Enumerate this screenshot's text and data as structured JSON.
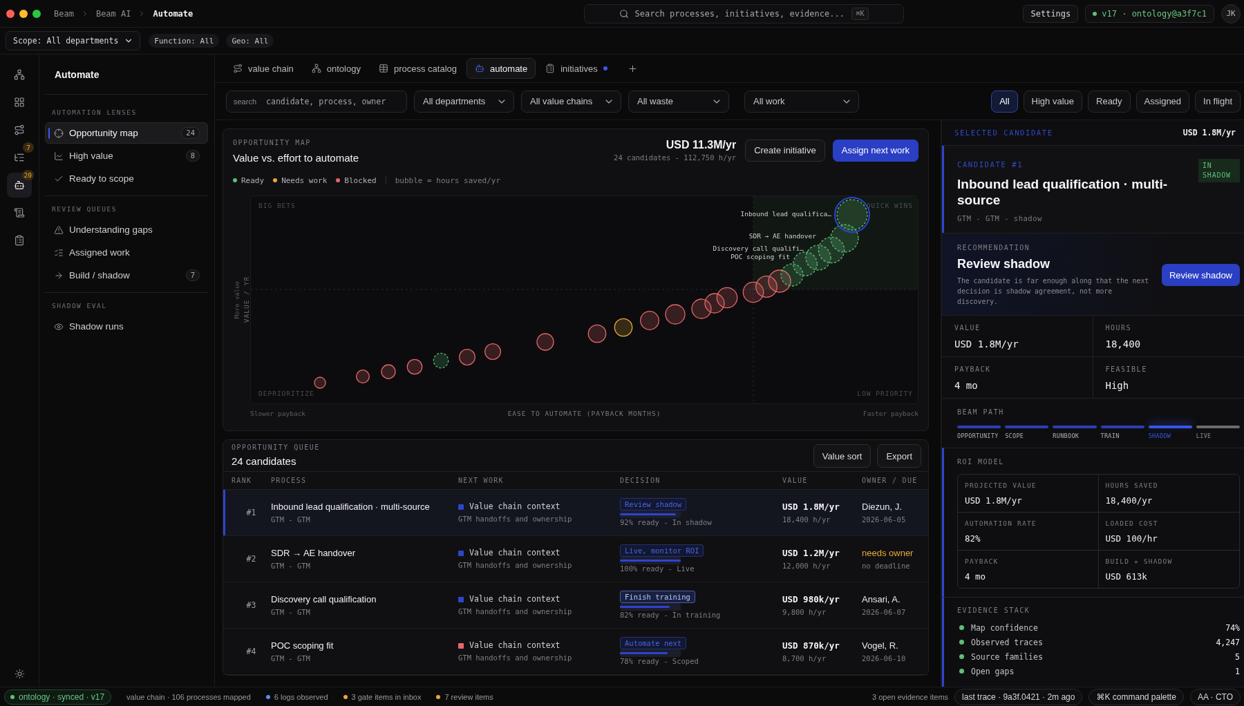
{
  "breadcrumb": [
    {
      "label": "Beam",
      "current": false
    },
    {
      "label": "Beam AI",
      "current": false
    },
    {
      "label": "Automate",
      "current": true
    }
  ],
  "command_search": {
    "placeholder": "Search processes, initiatives, evidence...",
    "shortcut": "⌘K"
  },
  "header_actions": {
    "settings": "Settings",
    "version": "v17 · ontology@a3f7c1",
    "avatar": "JK"
  },
  "scope_bar": {
    "scope": "Scope: All departments",
    "chips": [
      "Function: All",
      "Geo: All"
    ]
  },
  "rail": [
    {
      "selected": false
    },
    {
      "selected": false
    },
    {
      "selected": false
    },
    {
      "badge": "7",
      "selected": false
    },
    {
      "badge": "20",
      "selected": true
    },
    {
      "selected": false
    },
    {
      "selected": false
    }
  ],
  "sidebar": {
    "title": "Automate",
    "sections": [
      {
        "heading": "AUTOMATION LENSES",
        "items": [
          {
            "label": "Opportunity map",
            "count": "24",
            "selected": true
          },
          {
            "label": "High value",
            "count": "8",
            "selected": false
          },
          {
            "label": "Ready to scope",
            "selected": false
          }
        ]
      },
      {
        "heading": "REVIEW QUEUES",
        "items": [
          {
            "label": "Understanding gaps",
            "selected": false
          },
          {
            "label": "Assigned work",
            "selected": false
          },
          {
            "label": "Build / shadow",
            "count": "7",
            "selected": false
          }
        ]
      },
      {
        "heading": "SHADOW EVAL",
        "items": [
          {
            "label": "Shadow runs",
            "selected": false
          }
        ]
      }
    ]
  },
  "tabs": [
    {
      "label": "value chain",
      "selected": false,
      "unread": false
    },
    {
      "label": "ontology",
      "selected": false,
      "unread": false
    },
    {
      "label": "process catalog",
      "selected": false,
      "unread": false
    },
    {
      "label": "automate",
      "selected": true,
      "unread": false
    },
    {
      "label": "initiatives",
      "selected": false,
      "unread": true
    }
  ],
  "filters": {
    "search": {
      "label": "search",
      "placeholder": "candidate, process, owner"
    },
    "dropdowns": [
      "All departments",
      "All value chains",
      "All waste",
      "All work"
    ],
    "segments": [
      {
        "label": "All",
        "selected": true
      },
      {
        "label": "High value",
        "selected": false
      },
      {
        "label": "Ready",
        "selected": false
      },
      {
        "label": "Assigned",
        "selected": false
      },
      {
        "label": "In flight",
        "selected": false
      }
    ]
  },
  "opportunity_map": {
    "eyebrow": "OPPORTUNITY MAP",
    "title": "Value vs. effort to automate",
    "total": "USD 11.3M/yr",
    "subtotal": "24 candidates - 112,750 h/yr",
    "buttons": [
      {
        "label": "Create initiative",
        "primary": false
      },
      {
        "label": "Assign next work",
        "primary": true
      }
    ],
    "legend": [
      {
        "label": "Ready",
        "color": "#5fbf78"
      },
      {
        "label": "Needs work",
        "color": "#e8a93b"
      },
      {
        "label": "Blocked",
        "color": "#e5676a"
      }
    ],
    "legend_note": "bubble = hours saved/yr",
    "y_hint": "More value",
    "y_label": "VALUE / YR",
    "quadrants": [
      "BIG BETS",
      "QUICK WINS",
      "DEPRIORITIZE",
      "LOW PRIORITY"
    ],
    "bubble_labels": [
      "Inbound lead qualifica…",
      "SDR → AE handover",
      "Discovery call qualifi…",
      "POC scoping fit"
    ],
    "x_left": "Slower payback",
    "x_label": "EASE TO AUTOMATE (PAYBACK MONTHS)",
    "x_right": "Faster payback"
  },
  "queue": {
    "eyebrow": "OPPORTUNITY QUEUE",
    "title": "24 candidates",
    "buttons": [
      "Value sort",
      "Export"
    ],
    "columns": [
      "RANK",
      "PROCESS",
      "NEXT WORK",
      "DECISION",
      "VALUE",
      "OWNER / DUE"
    ],
    "rows": [
      {
        "rank": "#1",
        "process": "Inbound lead qualification · multi-source",
        "area": "GTM - GTM",
        "next_work": "Value chain context",
        "next_detail": "GTM handoffs and ownership",
        "color": "#2f45c8",
        "decision": "Review shadow",
        "highlighted": false,
        "level": 0.92,
        "readiness": "92% ready - In shadow",
        "value": "USD 1.8M/yr",
        "hours": "18,400 h/yr",
        "owner": "Diezun, J.",
        "owner_missing": false,
        "due": "2026-06-05",
        "selected": true
      },
      {
        "rank": "#2",
        "process": "SDR → AE handover",
        "area": "GTM - GTM",
        "next_work": "Value chain context",
        "next_detail": "GTM handoffs and ownership",
        "color": "#2f45c8",
        "decision": "Live, monitor ROI",
        "highlighted": false,
        "level": 1,
        "readiness": "100% ready - Live",
        "value": "USD 1.2M/yr",
        "hours": "12,000 h/yr",
        "owner": "needs owner",
        "owner_missing": true,
        "due": "no deadline",
        "selected": false
      },
      {
        "rank": "#3",
        "process": "Discovery call qualification",
        "area": "GTM - GTM",
        "next_work": "Value chain context",
        "next_detail": "GTM handoffs and ownership",
        "color": "#2f45c8",
        "decision": "Finish training",
        "highlighted": true,
        "level": 0.82,
        "readiness": "82% ready - In training",
        "value": "USD 980k/yr",
        "hours": "9,800 h/yr",
        "owner": "Ansari, A.",
        "owner_missing": false,
        "due": "2026-06-07",
        "selected": false
      },
      {
        "rank": "#4",
        "process": "POC scoping fit",
        "area": "GTM - GTM",
        "next_work": "Value chain context",
        "next_detail": "GTM handoffs and ownership",
        "color": "#e5676a",
        "decision": "Automate next",
        "highlighted": false,
        "level": 0.78,
        "readiness": "78% ready - Scoped",
        "value": "USD 870k/yr",
        "hours": "8,700 h/yr",
        "owner": "Vogel, R.",
        "owner_missing": false,
        "due": "2026-06-10",
        "selected": false
      }
    ]
  },
  "selected_candidate": {
    "heading": "SELECTED CANDIDATE",
    "value": "USD 1.8M/yr",
    "eyebrow": "CANDIDATE #1",
    "title": "Inbound lead qualification · multi-source",
    "meta": "GTM - GTM - shadow",
    "badge": "IN SHADOW",
    "recommendation": {
      "eyebrow": "RECOMMENDATION",
      "title": "Review shadow",
      "body": "The candidate is far enough along that the next decision is shadow agreement, not more discovery.",
      "button": "Review shadow"
    },
    "stats": [
      {
        "label": "VALUE",
        "value": "USD 1.8M/yr"
      },
      {
        "label": "HOURS",
        "value": "18,400"
      },
      {
        "label": "PAYBACK",
        "value": "4 mo"
      },
      {
        "label": "FEASIBLE",
        "value": "High"
      }
    ],
    "beam_path": {
      "heading": "BEAM PATH",
      "steps": [
        {
          "label": "OPPORTUNITY",
          "done": true,
          "current": false
        },
        {
          "label": "SCOPE",
          "done": true,
          "current": false
        },
        {
          "label": "RUNBOOK",
          "done": true,
          "current": false
        },
        {
          "label": "TRAIN",
          "done": true,
          "current": false
        },
        {
          "label": "SHADOW",
          "done": false,
          "current": true
        },
        {
          "label": "LIVE",
          "done": false,
          "current": false
        }
      ]
    },
    "roi_model": {
      "heading": "ROI MODEL",
      "cells": [
        {
          "label": "PROJECTED VALUE",
          "value": "USD 1.8M/yr"
        },
        {
          "label": "HOURS SAVED",
          "value": "18,400/yr"
        },
        {
          "label": "AUTOMATION RATE",
          "value": "82%"
        },
        {
          "label": "LOADED COST",
          "value": "USD 100/hr"
        },
        {
          "label": "PAYBACK",
          "value": "4 mo"
        },
        {
          "label": "BUILD + SHADOW",
          "value": "USD 613k"
        }
      ]
    },
    "evidence": {
      "heading": "EVIDENCE STACK",
      "items": [
        {
          "label": "Map confidence",
          "value": "74%"
        },
        {
          "label": "Observed traces",
          "value": "4,247"
        },
        {
          "label": "Source families",
          "value": "5"
        },
        {
          "label": "Open gaps",
          "value": "1"
        }
      ]
    }
  },
  "status_bar": {
    "sync": "ontology · synced · v17",
    "items": [
      {
        "label": "value chain · 106 processes mapped"
      },
      {
        "label": "6 logs observed",
        "color": "#5b8def"
      },
      {
        "label": "3 gate items in inbox",
        "color": "#e8a93b"
      },
      {
        "label": "7 review items",
        "color": "#e8a93b"
      }
    ],
    "evidence": "3 open evidence items",
    "pills": [
      "last trace · 9a3f.0421 · 2m ago",
      "⌘K command palette",
      "AA · CTO"
    ]
  }
}
